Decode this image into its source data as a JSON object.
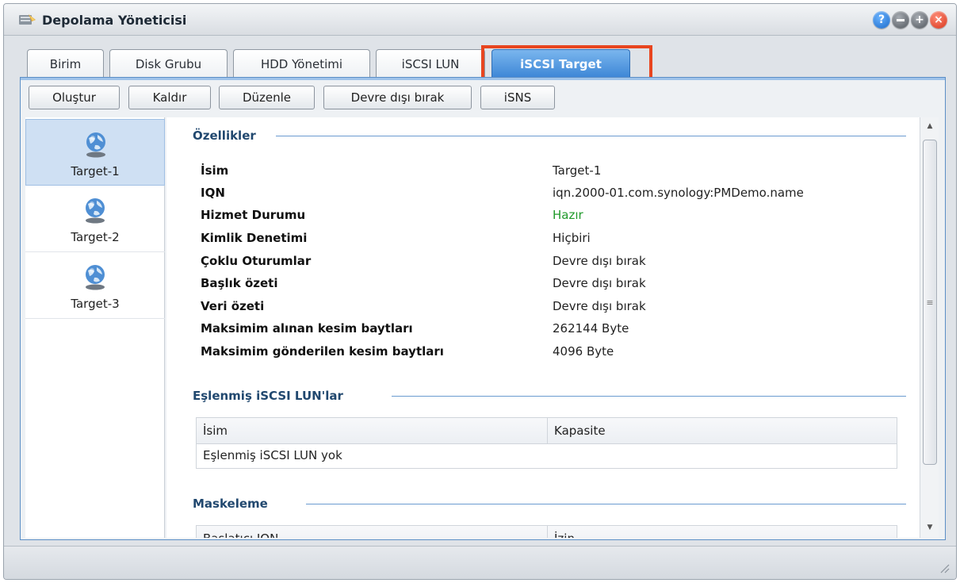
{
  "window": {
    "title": "Depolama Yöneticisi",
    "controls": [
      "help-icon",
      "minimize-icon",
      "maximize-icon",
      "close-icon"
    ]
  },
  "tabs": [
    {
      "label": "Birim",
      "active": false
    },
    {
      "label": "Disk Grubu",
      "active": false
    },
    {
      "label": "HDD Yönetimi",
      "active": false
    },
    {
      "label": "iSCSI LUN",
      "active": false
    },
    {
      "label": "iSCSI Target",
      "active": true
    }
  ],
  "toolbar": {
    "create": "Oluştur",
    "remove": "Kaldır",
    "edit": "Düzenle",
    "disable": "Devre dışı bırak",
    "isns": "iSNS"
  },
  "targets": [
    {
      "label": "Target-1",
      "selected": true,
      "icon": "globe-disk-icon"
    },
    {
      "label": "Target-2",
      "selected": false,
      "icon": "globe-disk-icon"
    },
    {
      "label": "Target-3",
      "selected": false,
      "icon": "globe-disk-icon"
    }
  ],
  "properties": {
    "title": "Özellikler",
    "rows": [
      {
        "label": "İsim",
        "value": "Target-1"
      },
      {
        "label": "IQN",
        "value": "iqn.2000-01.com.synology:PMDemo.name"
      },
      {
        "label": "Hizmet Durumu",
        "value": "Hazır"
      },
      {
        "label": "Kimlik Denetimi",
        "value": "Hiçbiri"
      },
      {
        "label": "Çoklu Oturumlar",
        "value": "Devre dışı bırak"
      },
      {
        "label": "Başlık özeti",
        "value": "Devre dışı bırak"
      },
      {
        "label": "Veri özeti",
        "value": "Devre dışı bırak"
      },
      {
        "label": "Maksimim alınan kesim baytları",
        "value": "262144 Byte"
      },
      {
        "label": "Maksimim gönderilen kesim baytları",
        "value": "4096 Byte"
      }
    ]
  },
  "mapped_luns": {
    "title": "Eşlenmiş iSCSI LUN'lar",
    "columns": [
      "İsim",
      "Kapasite"
    ],
    "empty_text": "Eşlenmiş iSCSI LUN yok"
  },
  "masking": {
    "title": "Maskeleme",
    "columns": [
      "Başlatıcı IQN",
      "İzin"
    ]
  },
  "colors": {
    "accent": "#3d86d6",
    "highlight": "#e8451f",
    "status_ready": "#1f9a2a",
    "section_title": "#21486f"
  }
}
